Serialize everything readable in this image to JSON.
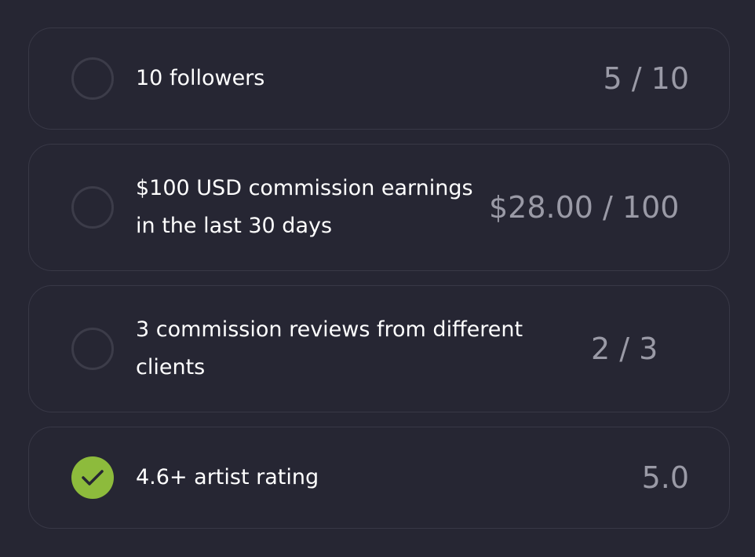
{
  "goals": [
    {
      "label": "10 followers",
      "progress": "5 / 10",
      "complete": false
    },
    {
      "label": "$100 USD commission earnings in the last 30 days",
      "progress": "$28.00 / 100",
      "complete": false
    },
    {
      "label": "3 commission reviews from different clients",
      "progress": "2 / 3",
      "complete": false
    },
    {
      "label": "4.6+ artist rating",
      "progress": "5.0",
      "complete": true
    }
  ],
  "icons": {
    "incomplete": "empty-circle-icon",
    "complete": "check-circle-icon"
  },
  "colors": {
    "background": "#262633",
    "card_border": "#383846",
    "complete_green": "#8dbb3c",
    "label_text": "#ffffff",
    "progress_text": "#9a9aa6"
  }
}
